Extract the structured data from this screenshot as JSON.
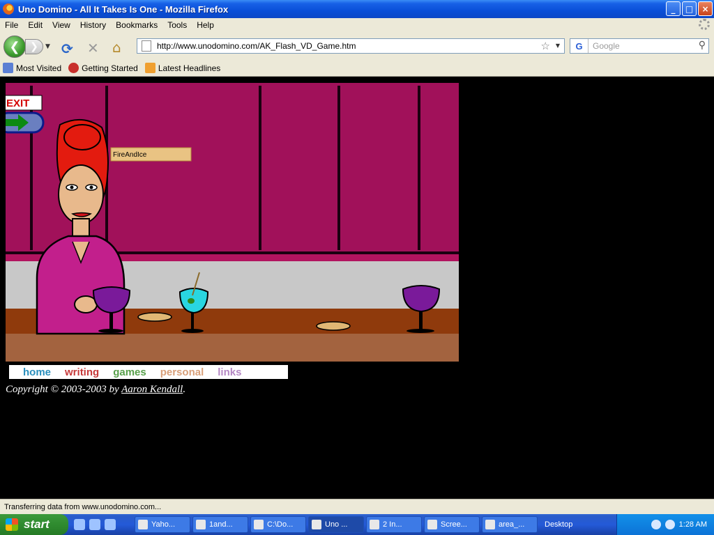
{
  "window": {
    "title": "Uno Domino - All It Takes Is One - Mozilla Firefox",
    "controls": [
      "_",
      "□",
      "×"
    ]
  },
  "menubar": {
    "items": [
      "File",
      "Edit",
      "View",
      "History",
      "Bookmarks",
      "Tools",
      "Help"
    ]
  },
  "navbar": {
    "url": "http://www.unodomino.com/AK_Flash_VD_Game.htm",
    "search_placeholder": "Google"
  },
  "bookmarks": {
    "items": [
      "Most Visited",
      "Getting Started",
      "Latest Headlines"
    ]
  },
  "game": {
    "exit_label": "EXIT",
    "player_tag": "FireAndIce"
  },
  "site_nav": {
    "home": "home",
    "writing": "writing",
    "games": "games",
    "personal": "personal",
    "links": "links"
  },
  "footer": {
    "copyright_prefix": "Copyright © 2003-2003 by ",
    "author": "Aaron Kendall",
    "suffix": "."
  },
  "statusbar": {
    "text": "Transferring data from www.unodomino.com..."
  },
  "taskbar": {
    "start_label": "start",
    "tasks": [
      "Yaho...",
      "1and...",
      "C:\\Do...",
      "Uno ...",
      "2 In...",
      "Scree...",
      "area_..."
    ],
    "desktop_label": "Desktop",
    "clock": "1:28 AM"
  }
}
